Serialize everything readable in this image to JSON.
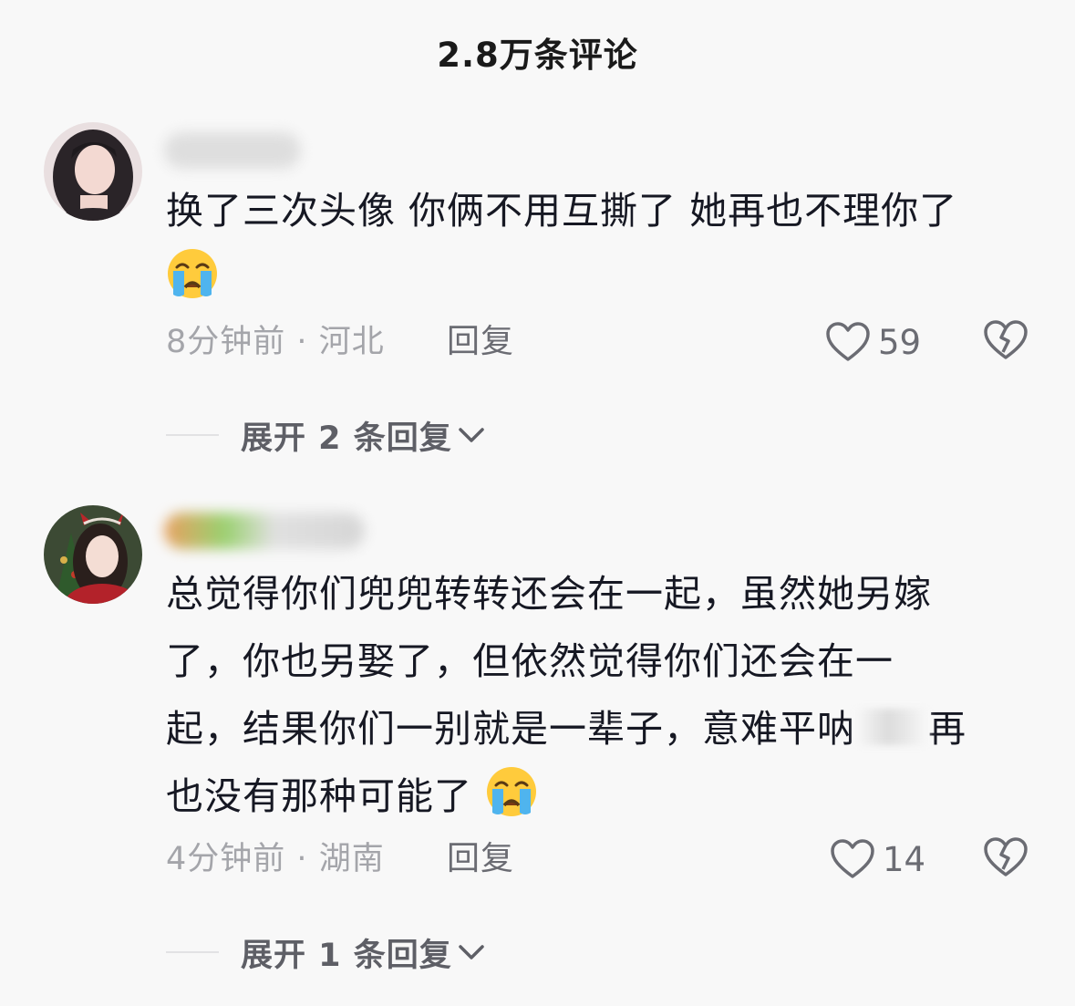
{
  "header": {
    "title": "2.8万条评论"
  },
  "comments": [
    {
      "text_line1": "换了三次头像 你俩不用互撕了 她再也不理你了",
      "emoji": "crying-face",
      "time": "8分钟前",
      "location": "河北",
      "reply_label": "回复",
      "likes": "59",
      "expand_label": "展开 2 条回复"
    },
    {
      "text_line1": "总觉得你们兜兜转转还会在一起，虽然她另嫁",
      "text_line2": "了，你也另娶了，但依然觉得你们还会在一",
      "text_line3a": "起，结果你们一别就是一辈子，意难平呐",
      "text_line3b": "再",
      "text_line4": "也没有那种可能了",
      "emoji": "crying-face",
      "time": "4分钟前",
      "location": "湖南",
      "reply_label": "回复",
      "likes": "14",
      "expand_label": "展开 1 条回复"
    }
  ],
  "colors": {
    "background": "#f8f8f8",
    "text_primary": "#161823",
    "text_secondary": "#a4a5aa",
    "action_gray": "#6b6c73"
  },
  "icons": {
    "like": "heart-outline-icon",
    "dislike": "broken-heart-icon",
    "expand": "chevron-down-icon"
  }
}
